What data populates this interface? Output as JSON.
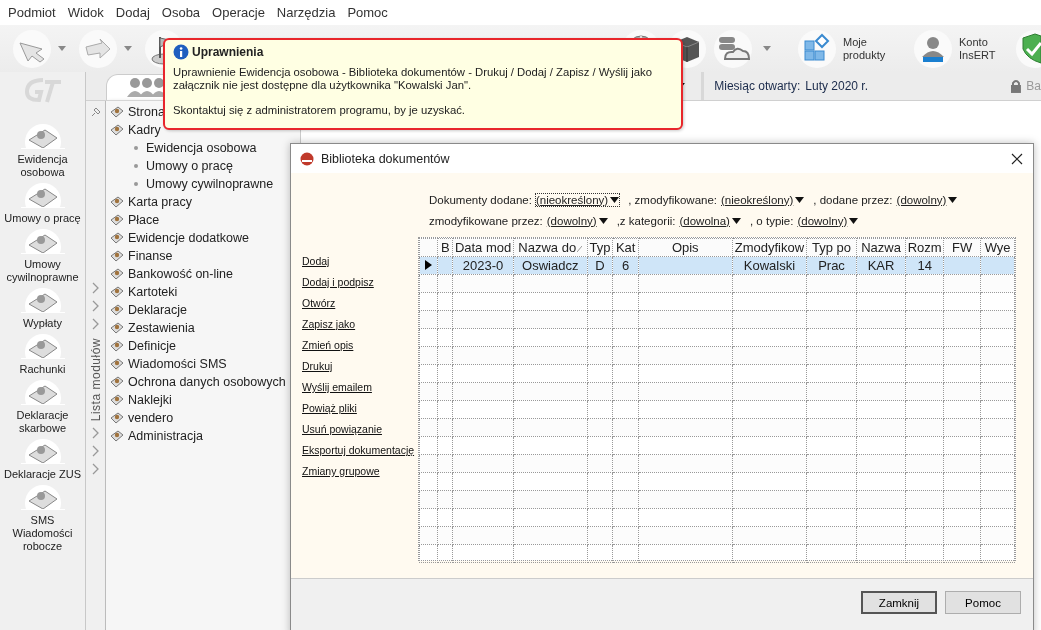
{
  "menu": [
    "Podmiot",
    "Widok",
    "Dodaj",
    "Osoba",
    "Operacje",
    "Narzędzia",
    "Pomoc"
  ],
  "toolbar": {
    "products_label": "Moje produkty",
    "account_label": "Konto InsERT"
  },
  "tab_bar": {
    "open_month_label": "Miesiąc otwarty:",
    "open_month": "Luty 2020 r.",
    "cut_label": "Ba"
  },
  "modules": [
    {
      "label": "Ewidencja osobowa"
    },
    {
      "label": "Umowy o pracę"
    },
    {
      "label": "Umowy cywilnoprawne"
    },
    {
      "label": "Wypłaty"
    },
    {
      "label": "Rachunki"
    },
    {
      "label": "Deklaracje skarbowe"
    },
    {
      "label": "Deklaracje ZUS"
    },
    {
      "label": "SMS Wiadomości robocze"
    }
  ],
  "module_strip": {
    "title": "Lista modułów"
  },
  "tree": [
    {
      "label": "Strona"
    },
    {
      "label": "Kadry",
      "children": [
        {
          "label": "Ewidencja osobowa"
        },
        {
          "label": "Umowy o pracę"
        },
        {
          "label": "Umowy cywilnoprawne"
        }
      ]
    },
    {
      "label": "Karta pracy"
    },
    {
      "label": "Płace"
    },
    {
      "label": "Ewidencje dodatkowe"
    },
    {
      "label": "Finanse"
    },
    {
      "label": "Bankowość on-line"
    },
    {
      "label": "Kartoteki"
    },
    {
      "label": "Deklaracje"
    },
    {
      "label": "Zestawienia"
    },
    {
      "label": "Definicje"
    },
    {
      "label": "Wiadomości SMS"
    },
    {
      "label": "Ochrona danych osobowych"
    },
    {
      "label": "Naklejki"
    },
    {
      "label": "vendero"
    },
    {
      "label": "Administracja"
    }
  ],
  "tooltip": {
    "title": "Uprawnienia",
    "paragraphs": [
      "Uprawnienie Ewidencja osobowa - Biblioteka dokumentów - Drukuj / Dodaj / Zapisz / Wyślij jako załącznik nie jest dostępne dla użytkownika \"Kowalski Jan\".",
      "Skontaktuj się z administratorem programu, by je uzyskać."
    ]
  },
  "dialog": {
    "title": "Biblioteka dokumentów",
    "filters": [
      [
        {
          "label": "Dokumenty dodane:",
          "value": "(nieokreślony)",
          "focused": true
        },
        {
          "label": ", zmodyfikowane:",
          "value": "(nieokreślony)",
          "focused": false
        },
        {
          "label": ", dodane przez:",
          "value": "(dowolny)",
          "focused": false
        }
      ],
      [
        {
          "label": "zmodyfikowane przez:",
          "value": "(dowolny)",
          "focused": false
        },
        {
          "label": ",z kategorii:",
          "value": "(dowolna)",
          "focused": false
        },
        {
          "label": ", o typie:",
          "value": "(dowolny)",
          "focused": false
        }
      ]
    ],
    "actions": [
      "Dodaj",
      "Dodaj i podpisz",
      "Otwórz",
      "Zapisz jako",
      "Zmień opis",
      "Drukuj",
      "Wyślij emailem",
      "Powiąż pliki",
      "Usuń powiązanie",
      "Eksportuj dokumentację",
      "Zmiany grupowe"
    ],
    "table": {
      "columns": [
        {
          "label": "B",
          "sorted": false
        },
        {
          "label": "Data mod",
          "sorted": false
        },
        {
          "label": "Nazwa do",
          "sorted": true
        },
        {
          "label": "Typ",
          "sorted": false
        },
        {
          "label": "Kat",
          "sorted": false
        },
        {
          "label": "Opis",
          "sorted": false
        },
        {
          "label": "Zmodyfikow",
          "sorted": false
        },
        {
          "label": "Typ po",
          "sorted": false
        },
        {
          "label": "Nazwa",
          "sorted": false
        },
        {
          "label": "Rozm",
          "sorted": false
        },
        {
          "label": "FW",
          "sorted": false
        },
        {
          "label": "Wye",
          "sorted": false
        }
      ],
      "rows": [
        {
          "selected": true,
          "cells": [
            null,
            "2023-0",
            "Oswiadcz",
            "D",
            "6",
            null,
            "Kowalski",
            "Prac",
            "KAR",
            "14",
            null,
            null
          ]
        }
      ]
    },
    "buttons": [
      {
        "label": "Zamknij",
        "default": true
      },
      {
        "label": "Pomoc",
        "default": false
      }
    ]
  }
}
